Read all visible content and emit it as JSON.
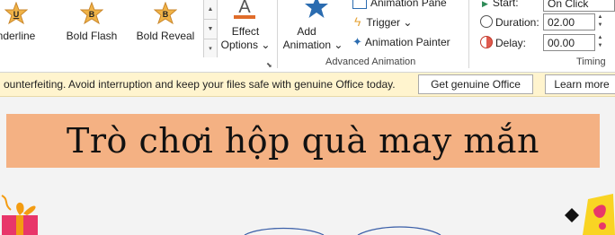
{
  "ribbon": {
    "gallery": [
      {
        "label": "nderline",
        "glyph": "U"
      },
      {
        "label": "Bold Flash",
        "glyph": "B"
      },
      {
        "label": "Bold Reveal",
        "glyph": "B"
      }
    ],
    "effect_options": {
      "line1": "Effect",
      "line2": "Options ⌄",
      "glyph": "A"
    },
    "add_animation": {
      "line1": "Add",
      "line2": "Animation ⌄"
    },
    "animation_pane": "Animation Pane",
    "trigger": "Trigger ⌄",
    "animation_painter": "Animation Painter",
    "group_advanced": "Advanced Animation",
    "timing": {
      "start_label": "Start:",
      "start_value": "On Click",
      "duration_label": "Duration:",
      "duration_value": "02.00",
      "delay_label": "Delay:",
      "delay_value": "00.00",
      "group_label": "Timing"
    }
  },
  "message_bar": {
    "text": "ounterfeiting. Avoid interruption and keep your files safe with genuine Office today.",
    "get_genuine": "Get genuine Office",
    "learn_more": "Learn more"
  },
  "slide": {
    "title": "Trò chơi hộp quà may mắn"
  },
  "colors": {
    "title_bg": "#f4b183",
    "message_bg": "#fff4ce",
    "star_gold": "#e6a53a",
    "star_blue": "#2b6cb0",
    "effect_orange": "#e06c2a"
  }
}
